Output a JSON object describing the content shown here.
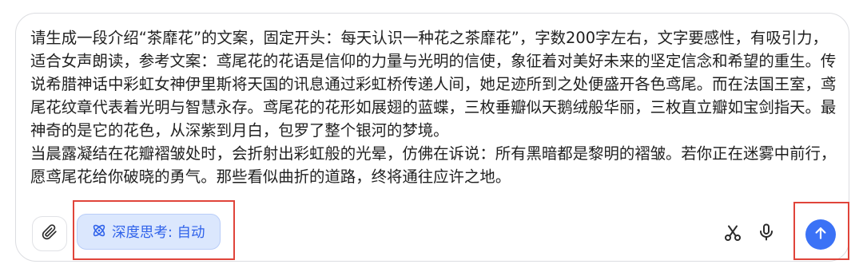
{
  "composer": {
    "prompt_text": "请生成一段介绍“茶靡花”的文案，固定开头：每天认识一种花之茶靡花”，字数200字左右，文字要感性，有吸引力，适合女声朗读，参考文案：鸢尾花的花语是信仰的力量与光明的信使，象征着对美好未来的坚定信念和希望的重生。传说希腊神话中彩虹女神伊里斯将天国的讯息通过彩虹桥传递人间，她足迹所到之处便盛开各色鸢尾。而在法国王室，鸢尾花纹章代表着光明与智慧永存。鸢尾花的花形如展翅的蓝蝶，三枚垂瓣似天鹅绒般华丽，三枚直立瓣如宝剑指天。最神奇的是它的花色，从深紫到月白，包罗了整个银河的梦境。\n当晨露凝结在花瓣褶皱处时，会折射出彩虹般的光晕，仿佛在诉说：所有黑暗都是黎明的褶皱。若你正在迷雾中前行，愿鸢尾花给你破晓的勇气。那些看似曲折的道路，终将通往应许之地。"
  },
  "toolbar": {
    "attach_icon": "paperclip-icon",
    "deep_think_icon": "atom-icon",
    "deep_think_label": "深度思考: 自动",
    "scissors_icon": "scissors-icon",
    "mic_icon": "microphone-icon",
    "send_icon": "arrow-up-icon"
  },
  "colors": {
    "accent": "#3b72f6",
    "deep_think_bg": "#dbe7fd",
    "deep_think_text": "#2f62ea",
    "highlight": "#e0443a"
  }
}
